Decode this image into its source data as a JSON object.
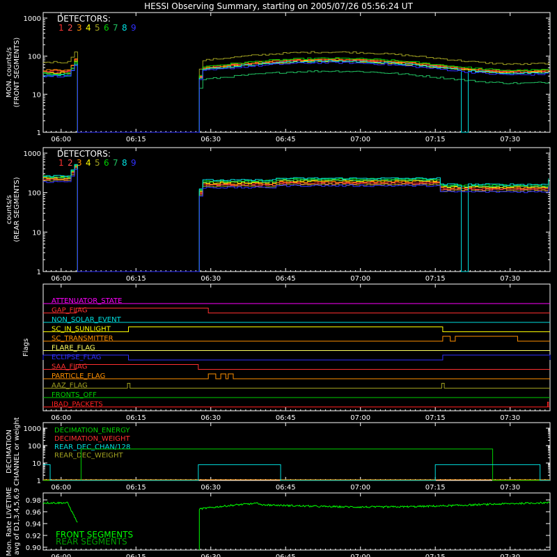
{
  "title": "HESSI Observing Summary, starting on 2005/07/26 05:56:24 UT",
  "time_axis": {
    "start_minutes": 56.4,
    "end_minutes": 158,
    "ticks": [
      {
        "t": 60,
        "label": "06:00"
      },
      {
        "t": 75,
        "label": "06:15"
      },
      {
        "t": 90,
        "label": "06:30"
      },
      {
        "t": 105,
        "label": "06:45"
      },
      {
        "t": 120,
        "label": "07:00"
      },
      {
        "t": 135,
        "label": "07:15"
      },
      {
        "t": 150,
        "label": "07:30"
      }
    ]
  },
  "detectors": {
    "legend_title": "DETECTORS:",
    "items": [
      {
        "n": "1",
        "color": "#ff3030"
      },
      {
        "n": "2",
        "color": "#ff5050"
      },
      {
        "n": "3",
        "color": "#ff9000"
      },
      {
        "n": "4",
        "color": "#ffff00"
      },
      {
        "n": "5",
        "color": "#a0a020"
      },
      {
        "n": "6",
        "color": "#00d000"
      },
      {
        "n": "7",
        "color": "#20c060"
      },
      {
        "n": "8",
        "color": "#00e0e0"
      },
      {
        "n": "9",
        "color": "#3030ff"
      }
    ]
  },
  "chart_data": [
    {
      "type": "line",
      "name": "front",
      "ylabel": "MON. counts/s",
      "ylabel2": "(FRONT SEGMENTS)",
      "yscale": "log",
      "ylim": [
        1,
        1000
      ],
      "yticks": [
        "1",
        "10",
        "100",
        "1000"
      ],
      "gaps": [
        [
          63.3,
          87.7
        ]
      ],
      "dropouts": [
        [
          139.5,
          141.5
        ]
      ],
      "series": [
        {
          "detector": "1",
          "pre_level": 40,
          "post_level": 60
        },
        {
          "detector": "2",
          "pre_level": 38,
          "post_level": 58
        },
        {
          "detector": "3",
          "pre_level": 42,
          "post_level": 62
        },
        {
          "detector": "4",
          "pre_level": 36,
          "post_level": 55
        },
        {
          "detector": "5",
          "pre_level": 70,
          "post_level": 95
        },
        {
          "detector": "6",
          "pre_level": 35,
          "post_level": 65
        },
        {
          "detector": "7",
          "pre_level": 34,
          "post_level": 30
        },
        {
          "detector": "8",
          "pre_level": 32,
          "post_level": 55
        },
        {
          "detector": "9",
          "pre_level": 30,
          "post_level": 50
        }
      ]
    },
    {
      "type": "line",
      "name": "rear",
      "ylabel": "counts/s",
      "ylabel2": "(REAR SEGMENTS)",
      "yscale": "log",
      "ylim": [
        1,
        1000
      ],
      "yticks": [
        "1",
        "10",
        "100",
        "1000"
      ],
      "gaps": [
        [
          63.3,
          87.7
        ]
      ],
      "dropouts": [
        [
          139.5,
          141.5
        ]
      ],
      "series": [
        {
          "detector": "1",
          "pre_level": 220,
          "post_level": 180
        },
        {
          "detector": "2",
          "pre_level": 210,
          "post_level": 170
        },
        {
          "detector": "3",
          "pre_level": 230,
          "post_level": 190
        },
        {
          "detector": "4",
          "pre_level": 240,
          "post_level": 200
        },
        {
          "detector": "5",
          "pre_level": 200,
          "post_level": 160
        },
        {
          "detector": "6",
          "pre_level": 260,
          "post_level": 220
        },
        {
          "detector": "7",
          "pre_level": 250,
          "post_level": 210
        },
        {
          "detector": "8",
          "pre_level": 270,
          "post_level": 230
        },
        {
          "detector": "9",
          "pre_level": 190,
          "post_level": 150
        }
      ]
    },
    {
      "type": "flags",
      "name": "flags",
      "ylabel": "Flags",
      "rows": [
        {
          "label": "ATTENUATOR_STATE",
          "color": "#ff00ff",
          "on": []
        },
        {
          "label": "GAP_FLAG",
          "color": "#ff3030",
          "on": [
            [
              63,
              89.5
            ]
          ]
        },
        {
          "label": "NON_SOLAR_EVENT",
          "color": "#00e0e0",
          "on": []
        },
        {
          "label": "SC_IN_SUNLIGHT",
          "color": "#ffff00",
          "on": [
            [
              73.5,
              136.5
            ]
          ]
        },
        {
          "label": "SC_TRANSMITTER",
          "color": "#ff9000",
          "on": [
            [
              136.5,
              138
            ],
            [
              139,
              151.5
            ]
          ]
        },
        {
          "label": "FLARE_FLAG",
          "color": "#ffff60",
          "on": []
        },
        {
          "label": "ECLIPSE_FLAG",
          "color": "#3030ff",
          "on": [
            [
              56.4,
              73.5
            ],
            [
              136.5,
              158
            ]
          ]
        },
        {
          "label": "SAA_FLAG",
          "color": "#ff3030",
          "on": [
            [
              63,
              87.5
            ]
          ]
        },
        {
          "label": "PARTICLE_FLAG",
          "color": "#ff9000",
          "on": [
            [
              89.5,
              91
            ],
            [
              92,
              93
            ],
            [
              93.5,
              94.5
            ]
          ]
        },
        {
          "label": "AAZ_FLAG",
          "color": "#a0a020",
          "on": [
            [
              73.3,
              73.8
            ],
            [
              136.3,
              136.8
            ]
          ]
        },
        {
          "label": "FRONTS_OFF",
          "color": "#00d000",
          "on": []
        },
        {
          "label": "IBAD_PACKETS",
          "color": "#ff2020",
          "on": [
            [
              157.5,
              157.7
            ]
          ]
        }
      ]
    },
    {
      "type": "line",
      "name": "decimation",
      "ylabel": "DECIMATION",
      "ylabel2": "CHANNEL or weight",
      "yscale": "log",
      "ylim": [
        1,
        1000
      ],
      "yticks": [
        "1",
        "10",
        "100",
        "1000"
      ],
      "series": [
        {
          "name": "DECIMATION_ENERGY",
          "color": "#00d000"
        },
        {
          "name": "DECIMATION_WEIGHT",
          "color": "#ff3030"
        },
        {
          "name": "REAR_DEC_CHAN/128",
          "color": "#00e0e0"
        },
        {
          "name": "REAR_DEC_WEIGHT",
          "color": "#a0a020"
        }
      ]
    },
    {
      "type": "line",
      "name": "livetime",
      "ylabel": "Mon. Rate LIVETIME",
      "ylabel2": "avg of D1,3,4,5,6,9",
      "ylim": [
        0.9,
        0.98
      ],
      "yticks": [
        "0.90",
        "0.92",
        "0.94",
        "0.96",
        "0.98"
      ],
      "series": [
        {
          "name": "FRONT SEGMENTS",
          "color": "#00ff00",
          "pre_level": 0.975,
          "post_level": 0.972
        },
        {
          "name": "REAR SEGMENTS",
          "color": "#00a000"
        }
      ]
    }
  ]
}
